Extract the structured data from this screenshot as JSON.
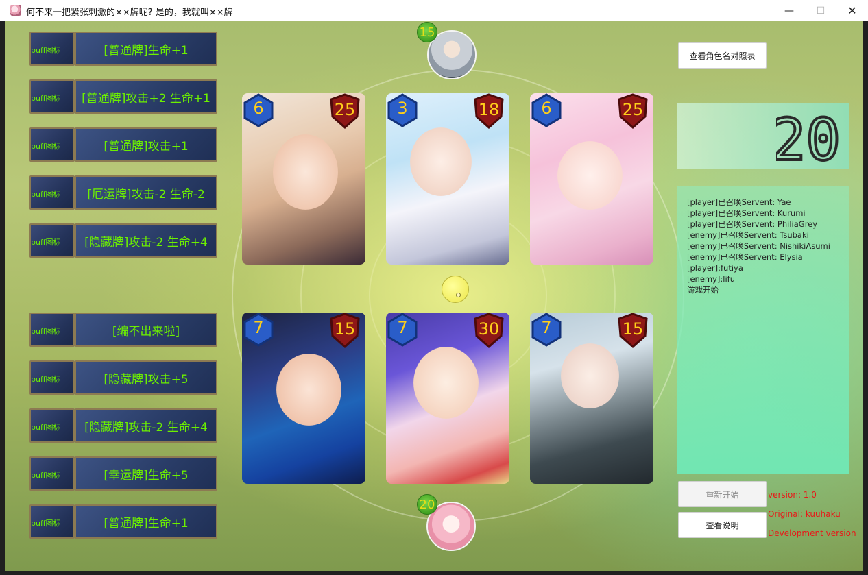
{
  "window": {
    "title": "何不来一把紧张刺激的××牌呢? 是的，我就叫××牌",
    "minimize": "—",
    "maximize": "☐",
    "close": "✕"
  },
  "buff_icon_text": "buff图标",
  "buffs_top": [
    {
      "label": "[普通牌]生命+1"
    },
    {
      "label": "[普通牌]攻击+2 生命+1"
    },
    {
      "label": "[普通牌]攻击+1"
    },
    {
      "label": "[厄运牌]攻击-2 生命-2"
    },
    {
      "label": "[隐藏牌]攻击-2 生命+4"
    }
  ],
  "buffs_bottom": [
    {
      "label": "[编不出来啦]"
    },
    {
      "label": "[隐藏牌]攻击+5"
    },
    {
      "label": "[隐藏牌]攻击-2 生命+4"
    },
    {
      "label": "[幸运牌]生命+5"
    },
    {
      "label": "[普通牌]生命+1"
    }
  ],
  "enemy": {
    "level": "15"
  },
  "player": {
    "level": "20"
  },
  "enemy_cards": [
    {
      "cost": "6",
      "health": "25"
    },
    {
      "cost": "3",
      "health": "18"
    },
    {
      "cost": "6",
      "health": "25"
    }
  ],
  "player_cards": [
    {
      "cost": "7",
      "health": "15"
    },
    {
      "cost": "7",
      "health": "30"
    },
    {
      "cost": "7",
      "health": "15"
    }
  ],
  "counter": {
    "value": "20"
  },
  "buttons": {
    "name_table": "查看角色名对照表",
    "restart": "重新开始",
    "instructions": "查看说明"
  },
  "log": [
    "[player]已召唤Servent: Yae",
    "[player]已召唤Servent: Kurumi",
    "[player]已召唤Servent: PhiliaGrey",
    "[enemy]已召唤Servent: Tsubaki",
    "[enemy]已召唤Servent: NishikiAsumi",
    "[enemy]已召唤Servent: Elysia",
    "[player]:futiya",
    "[enemy]:lifu",
    "游戏开始"
  ],
  "version": {
    "version": "version: 1.0",
    "original": "Original: kuuhaku",
    "dev": "Development version"
  },
  "colors": {
    "buff_text": "#6cf000",
    "stat_text": "#ffcf1a",
    "version_text": "#e81818"
  }
}
